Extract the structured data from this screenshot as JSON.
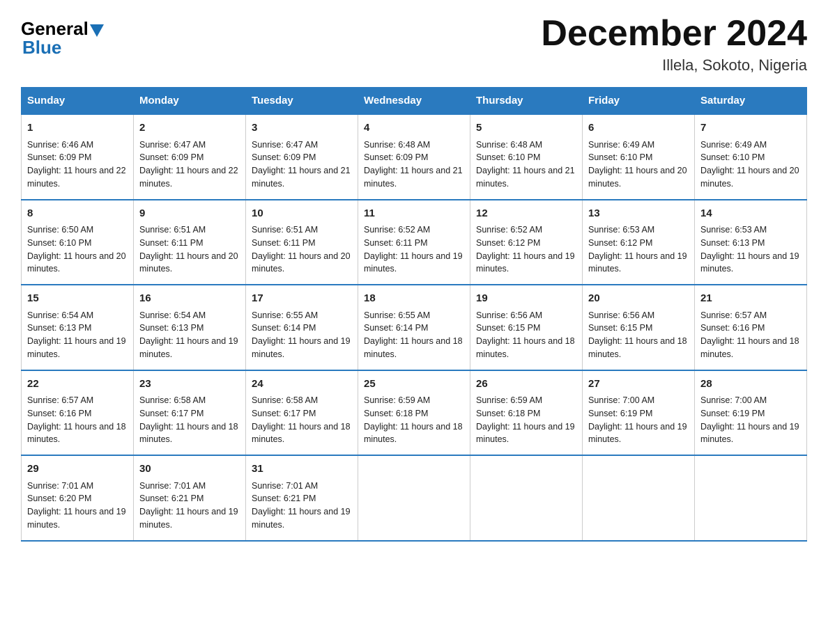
{
  "logo": {
    "general": "General",
    "blue": "Blue"
  },
  "title": "December 2024",
  "subtitle": "Illela, Sokoto, Nigeria",
  "days": [
    "Sunday",
    "Monday",
    "Tuesday",
    "Wednesday",
    "Thursday",
    "Friday",
    "Saturday"
  ],
  "weeks": [
    [
      {
        "num": "1",
        "sunrise": "6:46 AM",
        "sunset": "6:09 PM",
        "daylight": "11 hours and 22 minutes."
      },
      {
        "num": "2",
        "sunrise": "6:47 AM",
        "sunset": "6:09 PM",
        "daylight": "11 hours and 22 minutes."
      },
      {
        "num": "3",
        "sunrise": "6:47 AM",
        "sunset": "6:09 PM",
        "daylight": "11 hours and 21 minutes."
      },
      {
        "num": "4",
        "sunrise": "6:48 AM",
        "sunset": "6:09 PM",
        "daylight": "11 hours and 21 minutes."
      },
      {
        "num": "5",
        "sunrise": "6:48 AM",
        "sunset": "6:10 PM",
        "daylight": "11 hours and 21 minutes."
      },
      {
        "num": "6",
        "sunrise": "6:49 AM",
        "sunset": "6:10 PM",
        "daylight": "11 hours and 20 minutes."
      },
      {
        "num": "7",
        "sunrise": "6:49 AM",
        "sunset": "6:10 PM",
        "daylight": "11 hours and 20 minutes."
      }
    ],
    [
      {
        "num": "8",
        "sunrise": "6:50 AM",
        "sunset": "6:10 PM",
        "daylight": "11 hours and 20 minutes."
      },
      {
        "num": "9",
        "sunrise": "6:51 AM",
        "sunset": "6:11 PM",
        "daylight": "11 hours and 20 minutes."
      },
      {
        "num": "10",
        "sunrise": "6:51 AM",
        "sunset": "6:11 PM",
        "daylight": "11 hours and 20 minutes."
      },
      {
        "num": "11",
        "sunrise": "6:52 AM",
        "sunset": "6:11 PM",
        "daylight": "11 hours and 19 minutes."
      },
      {
        "num": "12",
        "sunrise": "6:52 AM",
        "sunset": "6:12 PM",
        "daylight": "11 hours and 19 minutes."
      },
      {
        "num": "13",
        "sunrise": "6:53 AM",
        "sunset": "6:12 PM",
        "daylight": "11 hours and 19 minutes."
      },
      {
        "num": "14",
        "sunrise": "6:53 AM",
        "sunset": "6:13 PM",
        "daylight": "11 hours and 19 minutes."
      }
    ],
    [
      {
        "num": "15",
        "sunrise": "6:54 AM",
        "sunset": "6:13 PM",
        "daylight": "11 hours and 19 minutes."
      },
      {
        "num": "16",
        "sunrise": "6:54 AM",
        "sunset": "6:13 PM",
        "daylight": "11 hours and 19 minutes."
      },
      {
        "num": "17",
        "sunrise": "6:55 AM",
        "sunset": "6:14 PM",
        "daylight": "11 hours and 19 minutes."
      },
      {
        "num": "18",
        "sunrise": "6:55 AM",
        "sunset": "6:14 PM",
        "daylight": "11 hours and 18 minutes."
      },
      {
        "num": "19",
        "sunrise": "6:56 AM",
        "sunset": "6:15 PM",
        "daylight": "11 hours and 18 minutes."
      },
      {
        "num": "20",
        "sunrise": "6:56 AM",
        "sunset": "6:15 PM",
        "daylight": "11 hours and 18 minutes."
      },
      {
        "num": "21",
        "sunrise": "6:57 AM",
        "sunset": "6:16 PM",
        "daylight": "11 hours and 18 minutes."
      }
    ],
    [
      {
        "num": "22",
        "sunrise": "6:57 AM",
        "sunset": "6:16 PM",
        "daylight": "11 hours and 18 minutes."
      },
      {
        "num": "23",
        "sunrise": "6:58 AM",
        "sunset": "6:17 PM",
        "daylight": "11 hours and 18 minutes."
      },
      {
        "num": "24",
        "sunrise": "6:58 AM",
        "sunset": "6:17 PM",
        "daylight": "11 hours and 18 minutes."
      },
      {
        "num": "25",
        "sunrise": "6:59 AM",
        "sunset": "6:18 PM",
        "daylight": "11 hours and 18 minutes."
      },
      {
        "num": "26",
        "sunrise": "6:59 AM",
        "sunset": "6:18 PM",
        "daylight": "11 hours and 19 minutes."
      },
      {
        "num": "27",
        "sunrise": "7:00 AM",
        "sunset": "6:19 PM",
        "daylight": "11 hours and 19 minutes."
      },
      {
        "num": "28",
        "sunrise": "7:00 AM",
        "sunset": "6:19 PM",
        "daylight": "11 hours and 19 minutes."
      }
    ],
    [
      {
        "num": "29",
        "sunrise": "7:01 AM",
        "sunset": "6:20 PM",
        "daylight": "11 hours and 19 minutes."
      },
      {
        "num": "30",
        "sunrise": "7:01 AM",
        "sunset": "6:21 PM",
        "daylight": "11 hours and 19 minutes."
      },
      {
        "num": "31",
        "sunrise": "7:01 AM",
        "sunset": "6:21 PM",
        "daylight": "11 hours and 19 minutes."
      },
      null,
      null,
      null,
      null
    ]
  ]
}
